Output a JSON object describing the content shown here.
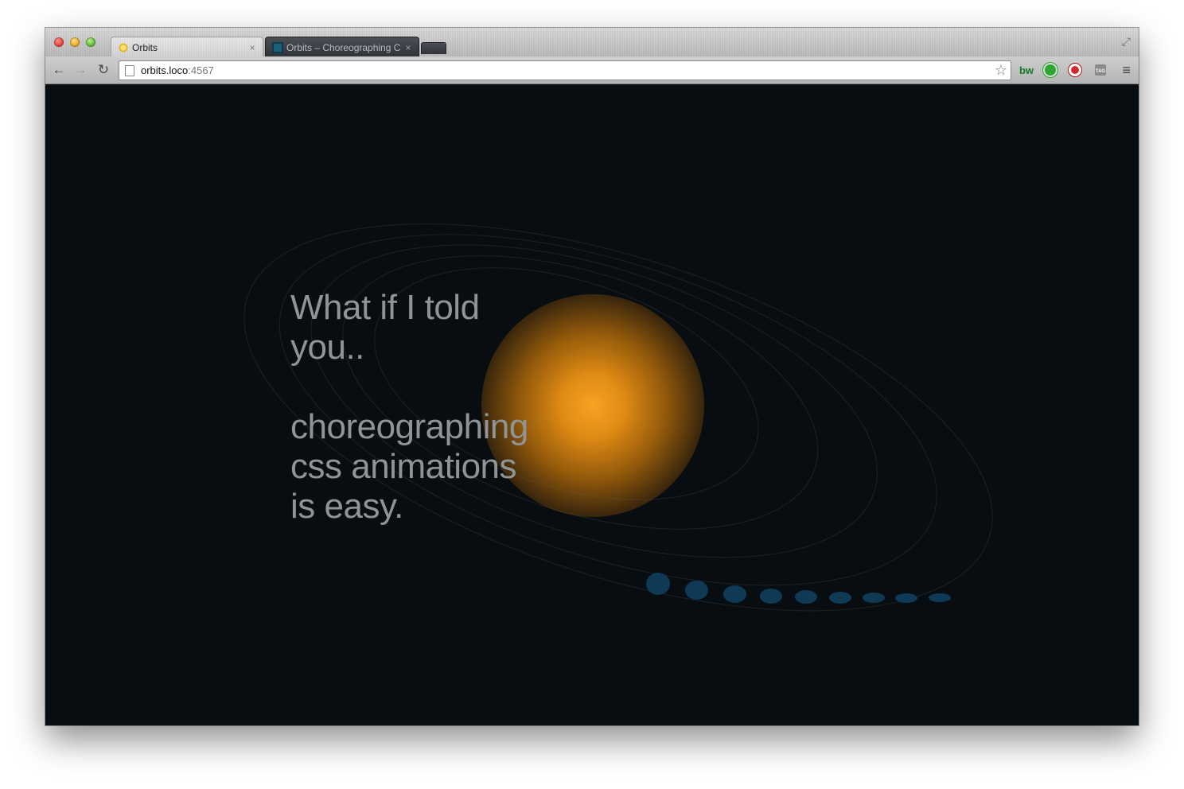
{
  "browser": {
    "tabs": [
      {
        "label": "Orbits",
        "close": "×",
        "favicon": "sun-favicon-icon"
      },
      {
        "label": "Orbits – Choreographing C",
        "close": "×",
        "favicon": "grid-favicon-icon"
      }
    ],
    "expand_icon": "⤢",
    "nav": {
      "back": "←",
      "forward": "→",
      "reload": "↻"
    },
    "url": {
      "host": "orbits.loco",
      "port": ":4567"
    },
    "star": "☆",
    "extensions": [
      {
        "name": "bw",
        "label": "bw"
      },
      {
        "name": "green-extension-icon"
      },
      {
        "name": "red-extension-icon"
      },
      {
        "name": "tag-extension-icon",
        "label": "TAG"
      }
    ],
    "menu": "≡"
  },
  "page": {
    "line1": "What if I told",
    "line2": "you..",
    "line3": "choreographing",
    "line4": "css animations",
    "line5": "is easy."
  },
  "colors": {
    "background": "#080d11",
    "sun": "#f7a323",
    "text": "#8f9497",
    "planet": "#0e3a55",
    "orbit": "#1b2126"
  }
}
